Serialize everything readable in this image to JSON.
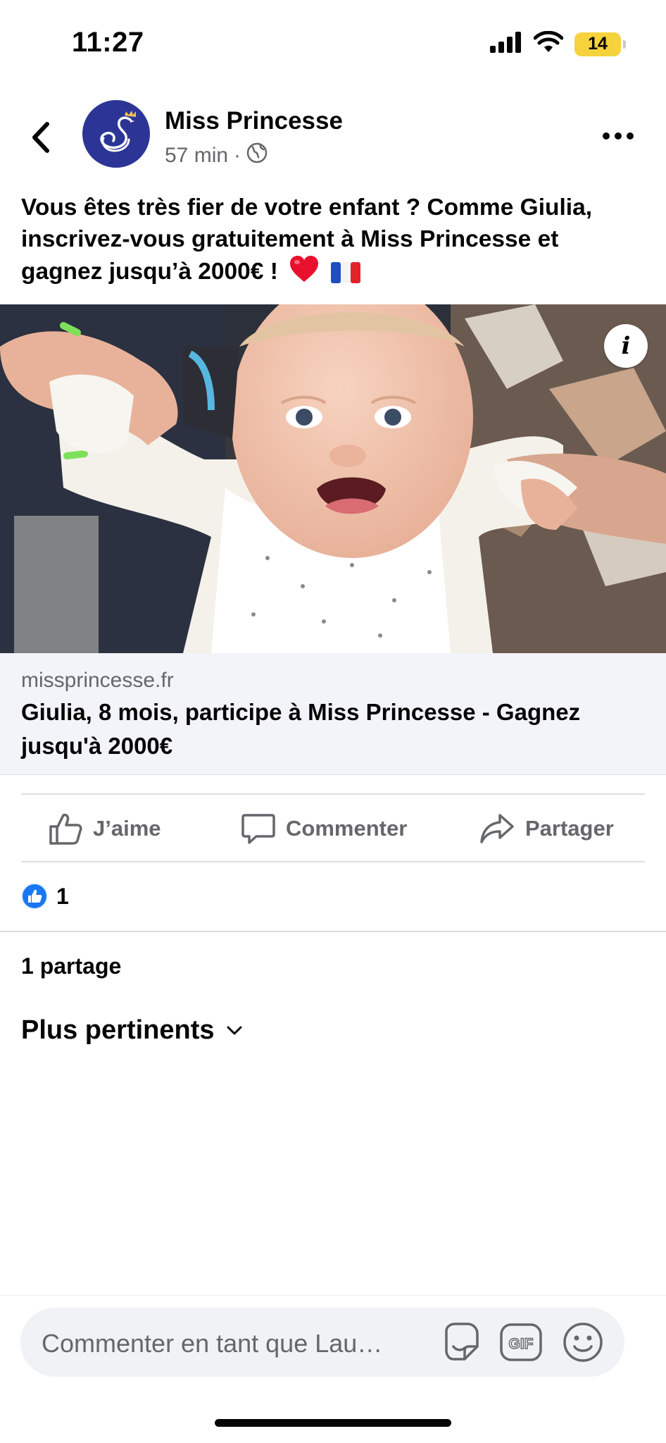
{
  "status_bar": {
    "time": "11:27",
    "battery_level": "14",
    "icons": [
      "signal-icon",
      "wifi-icon",
      "battery-icon"
    ]
  },
  "post": {
    "page_name": "Miss Princesse",
    "timestamp": "57 min",
    "separator": "·",
    "audience_icon": "globe-icon",
    "text": "Vous êtes très fier de votre enfant ? Comme Giulia, inscrivez-vous gratuitement à Miss Princesse et gagnez jusqu’à 2000€ !",
    "text_emojis": [
      "❤️",
      "🇫🇷"
    ],
    "image_info_label": "i"
  },
  "link_preview": {
    "domain": "missprincesse.fr",
    "title": "Giulia, 8 mois, participe à Miss Princesse - Gagnez jusqu'à 2000€"
  },
  "actions": {
    "like": "J’aime",
    "comment": "Commenter",
    "share": "Partager"
  },
  "reactions": {
    "count": "1",
    "type_icon": "thumbs-up-icon"
  },
  "shares_text": "1 partage",
  "sort_label": "Plus pertinents",
  "composer": {
    "placeholder": "Commenter en tant que Lau…",
    "gif_label": "GIF",
    "icons": [
      "sticker-icon",
      "gif-icon",
      "emoji-icon"
    ]
  },
  "colors": {
    "facebook_blue": "#1877f2",
    "secondary_text": "#65676b",
    "avatar_blue": "#2c3596",
    "battery_yellow": "#f6d23c",
    "link_preview_bg": "#f3f4f9"
  }
}
